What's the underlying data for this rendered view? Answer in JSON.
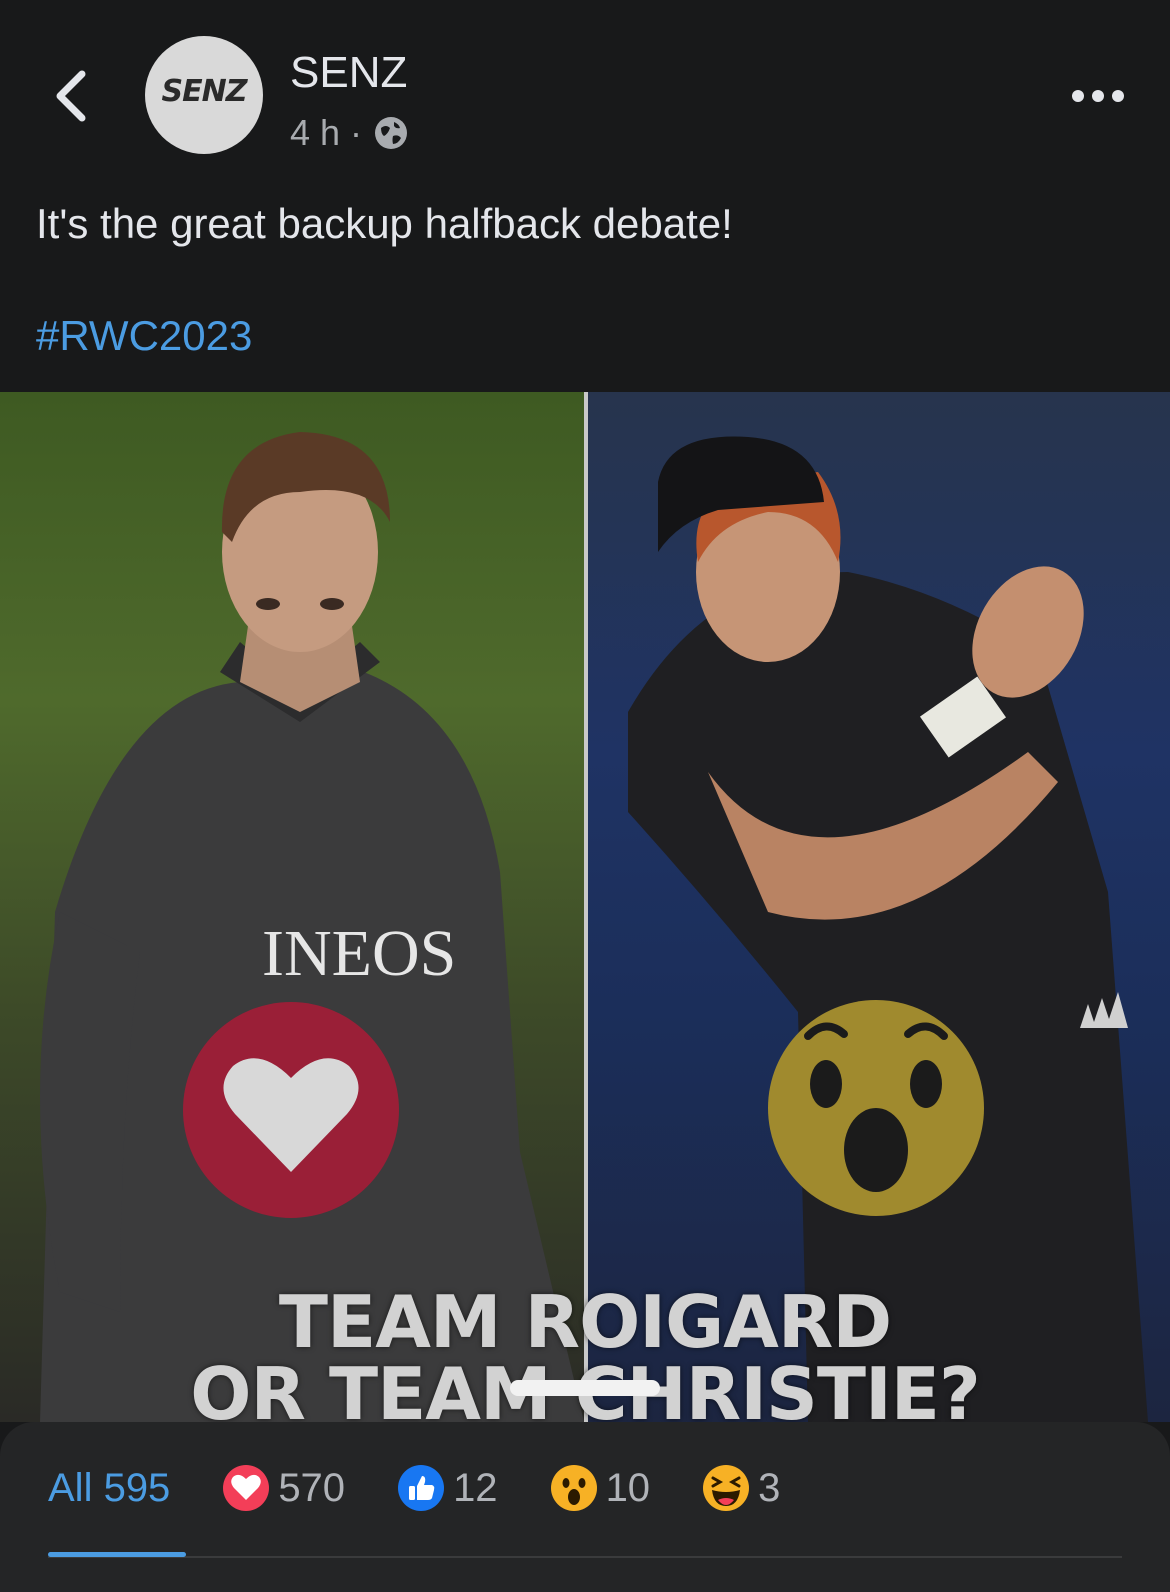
{
  "header": {
    "page_name": "SENZ",
    "avatar_logo": "SENZ",
    "time": "4 h ·",
    "back_icon": "chevron-left-icon",
    "more_icon": "more-horizontal-icon",
    "privacy_icon": "globe-icon"
  },
  "post": {
    "text": "It's the great backup halfback debate!",
    "hashtag": "#RWC2023"
  },
  "media": {
    "title_line1": "TEAM ROIGARD",
    "title_line2": "OR TEAM CHRISTIE?",
    "left_reaction_icon": "love-reaction-icon",
    "right_reaction_icon": "wow-reaction-icon",
    "left_jersey_text": "INEOS"
  },
  "reactions": {
    "all_label": "All 595",
    "tabs": [
      {
        "icon": "love-reaction-icon",
        "count": "570"
      },
      {
        "icon": "like-reaction-icon",
        "count": "12"
      },
      {
        "icon": "wow-reaction-icon",
        "count": "10"
      },
      {
        "icon": "haha-reaction-icon",
        "count": "3"
      }
    ]
  },
  "colors": {
    "background": "#18191a",
    "sheet": "#242526",
    "link": "#4b9ce2",
    "love": "#f33e58",
    "like": "#1877f2",
    "wow": "#f7b125"
  }
}
